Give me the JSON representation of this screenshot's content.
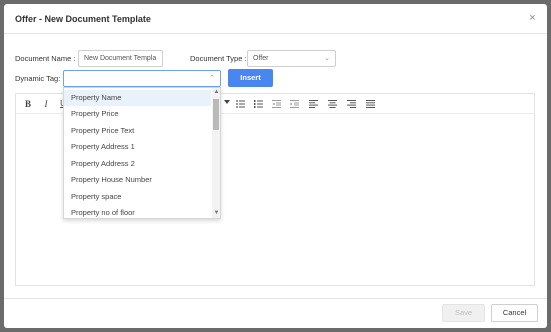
{
  "modal": {
    "title": "Offer - New Document Template",
    "close_glyph": "×"
  },
  "form": {
    "document_name_label": "Document Name :",
    "document_name_value": "New Document Templa",
    "document_type_label": "Document Type :",
    "document_type_value": "Offer",
    "dynamic_tag_label": "Dynamic Tag:",
    "dynamic_tag_value": "",
    "insert_label": "Insert"
  },
  "toolbar": {
    "bold": "B",
    "italic": "I",
    "underline": "U"
  },
  "dropdown": {
    "items": [
      "Property Name",
      "Property Price",
      "Property Price Text",
      "Property Address 1",
      "Property Address 2",
      "Property House Number",
      "Property space",
      "Property no of floor"
    ],
    "highlighted": "Property Name"
  },
  "footer": {
    "save_label": "Save",
    "cancel_label": "Cancel"
  },
  "colors": {
    "accent": "#4a86f0",
    "highlight": "#e9f1fb",
    "overlay": "#6b6b6b"
  }
}
